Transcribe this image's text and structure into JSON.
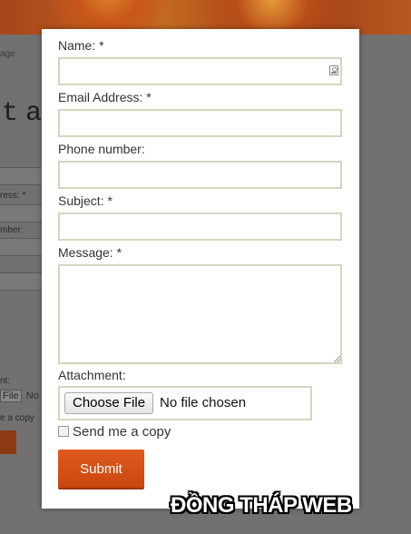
{
  "background": {
    "breadcrumb": "age",
    "big_title": "ta",
    "labels": [
      "ress: *",
      "mber:",
      "nt:"
    ],
    "file_button": "File",
    "file_status": "No f",
    "copy_text": "e a copy"
  },
  "form": {
    "name_label": "Name: *",
    "email_label": "Email Address: *",
    "phone_label": "Phone number:",
    "subject_label": "Subject: *",
    "message_label": "Message: *",
    "attachment_label": "Attachment:",
    "choose_file_label": "Choose File",
    "file_status": "No file chosen",
    "send_copy_label": "Send me a copy",
    "submit_label": "Submit"
  },
  "watermark": "ĐỒNG THÁP WEB",
  "colors": {
    "submit": "#d9531c",
    "input_border": "#d8d3c0",
    "overlay": "#6b6a69"
  }
}
